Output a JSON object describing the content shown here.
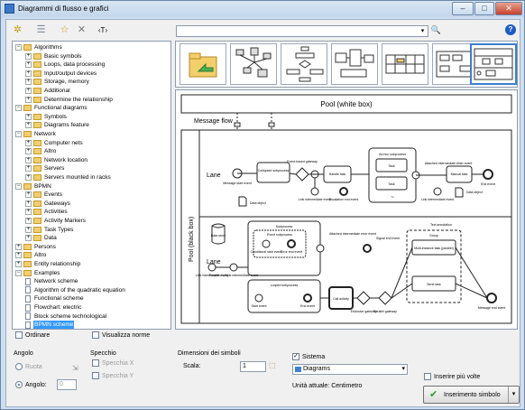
{
  "window": {
    "title": "Diagrammi di flusso e grafici",
    "minimize": "–",
    "maximize": "□",
    "close": "✕"
  },
  "toolbar": {
    "icons": [
      "gear-icon",
      "list-icon",
      "star-icon",
      "delete-icon",
      "text-icon"
    ],
    "text_icon_label": "‹T›",
    "combo_value": "",
    "combo_arrow": "▾",
    "search_icon": "🔍",
    "help_icon": "?"
  },
  "tree": [
    {
      "label": "Algorithms",
      "level": 0,
      "type": "folder",
      "exp": "−"
    },
    {
      "label": "Basic symbols",
      "level": 1,
      "type": "folder",
      "exp": "+"
    },
    {
      "label": "Loops, data processing",
      "level": 1,
      "type": "folder",
      "exp": "+"
    },
    {
      "label": "Input/output devices",
      "level": 1,
      "type": "folder",
      "exp": "+"
    },
    {
      "label": "Storage, memory",
      "level": 1,
      "type": "folder",
      "exp": "+"
    },
    {
      "label": "Additional",
      "level": 1,
      "type": "folder",
      "exp": "+"
    },
    {
      "label": "Determine the relationship",
      "level": 1,
      "type": "folder",
      "exp": "+"
    },
    {
      "label": "Functional diagrams",
      "level": 0,
      "type": "folder",
      "exp": "−"
    },
    {
      "label": "Symbols",
      "level": 1,
      "type": "folder",
      "exp": "+"
    },
    {
      "label": "Diagrams feature",
      "level": 1,
      "type": "folder",
      "exp": "+"
    },
    {
      "label": "Network",
      "level": 0,
      "type": "folder",
      "exp": "−"
    },
    {
      "label": "Computer nets",
      "level": 1,
      "type": "folder",
      "exp": "+"
    },
    {
      "label": "Altro",
      "level": 1,
      "type": "folder",
      "exp": "+"
    },
    {
      "label": "Network location",
      "level": 1,
      "type": "folder",
      "exp": "+"
    },
    {
      "label": "Servers",
      "level": 1,
      "type": "folder",
      "exp": "+"
    },
    {
      "label": "Servers mounted in racks",
      "level": 1,
      "type": "folder",
      "exp": "+"
    },
    {
      "label": "BPMN",
      "level": 0,
      "type": "folder",
      "exp": "−"
    },
    {
      "label": "Events",
      "level": 1,
      "type": "folder",
      "exp": "+"
    },
    {
      "label": "Gateways",
      "level": 1,
      "type": "folder",
      "exp": "+"
    },
    {
      "label": "Activities",
      "level": 1,
      "type": "folder",
      "exp": "+"
    },
    {
      "label": "Activity Markers",
      "level": 1,
      "type": "folder",
      "exp": "+"
    },
    {
      "label": "Task Types",
      "level": 1,
      "type": "folder",
      "exp": "+"
    },
    {
      "label": "Data",
      "level": 1,
      "type": "folder",
      "exp": "+"
    },
    {
      "label": "Persons",
      "level": 0,
      "type": "folder",
      "exp": "+"
    },
    {
      "label": "Altro",
      "level": 0,
      "type": "folder",
      "exp": "+"
    },
    {
      "label": "Entity relationship",
      "level": 0,
      "type": "folder",
      "exp": "+"
    },
    {
      "label": "Examples",
      "level": 0,
      "type": "folder",
      "exp": "−"
    },
    {
      "label": "Network scheme",
      "level": 1,
      "type": "doc"
    },
    {
      "label": "Algorithm of the quadratic equation",
      "level": 1,
      "type": "doc"
    },
    {
      "label": "Functional scheme",
      "level": 1,
      "type": "doc"
    },
    {
      "label": "Flowchart: electric",
      "level": 1,
      "type": "doc"
    },
    {
      "label": "Block scheme technological",
      "level": 1,
      "type": "doc"
    },
    {
      "label": "BPMN scheme",
      "level": 1,
      "type": "doc",
      "selected": true
    }
  ],
  "diagram": {
    "pool_top": "Pool (white box)",
    "message_flow": "Message flow",
    "pool_black": "Pool (black box)",
    "lane1": "Lane",
    "lane2": "Lane",
    "labels": {
      "message_start": "Message start event",
      "data_object_1": "Data object",
      "collapsed_subprocess": "Collapsed subprocess",
      "event_based_gateway": "Event-based gateway",
      "handle_task": "Handle task",
      "adhoc": "Ad-hoc subprocess",
      "task1": "Task",
      "task2": "Task",
      "attached": "Attached intermediate timer event",
      "manual_task": "Manual task",
      "end_event_1": "End event",
      "data_object_2": "Data object",
      "link_int_1": "Link intermediate event",
      "escalation": "Escalation end event",
      "link_int_2": "Link intermediate event",
      "text_annotation": "Text annotation",
      "data_store": "Data store",
      "subprocess": "Subprocess",
      "event_subprocess": "Event subprocess",
      "conditional_start": "Conditional start event",
      "error_end": "Error end event",
      "attached_int": "Attached intermediate error event",
      "signal_end": "Signal end event",
      "group": "Group",
      "multi_instance": "Multi-instance task (parallel)",
      "send_task": "Send task",
      "link_int_3": "Link intermediate event",
      "parallel_multiple": "Parallel multiple intermediate event",
      "looped_subprocess": "Looped subprocess",
      "start_event": "Start event",
      "end_event_2": "End event",
      "call_activity": "Call activity",
      "exclusive_gateway": "Exclusive gateway",
      "parallel_gateway": "Parallel gateway",
      "message_end": "Message end event",
      "tilde": "~"
    }
  },
  "options": {
    "ordinare": "Ordinare",
    "visualizza_norme": "Visualizza norme"
  },
  "angolo": {
    "title": "Angolo",
    "ruota": "Ruota",
    "angolo_label": "Angolo:",
    "angolo_value": "0"
  },
  "specchio": {
    "title": "Specchio",
    "x": "Specchia X",
    "y": "Specchia Y"
  },
  "dimensioni": {
    "title": "Dimensioni dei simboli",
    "scala_label": "Scala:",
    "scala_value": "1"
  },
  "sistema": {
    "label": "Sistema",
    "checked": "✓",
    "combo_value": "Diagrams",
    "combo_arrow": "▾"
  },
  "unita": "Unità attuale: Centimetro",
  "inserire_piu_volte": "Inserire più volte",
  "inserimento_button": {
    "label": "Inserimento simbolo",
    "check": "✔",
    "dropdown": "▾"
  }
}
